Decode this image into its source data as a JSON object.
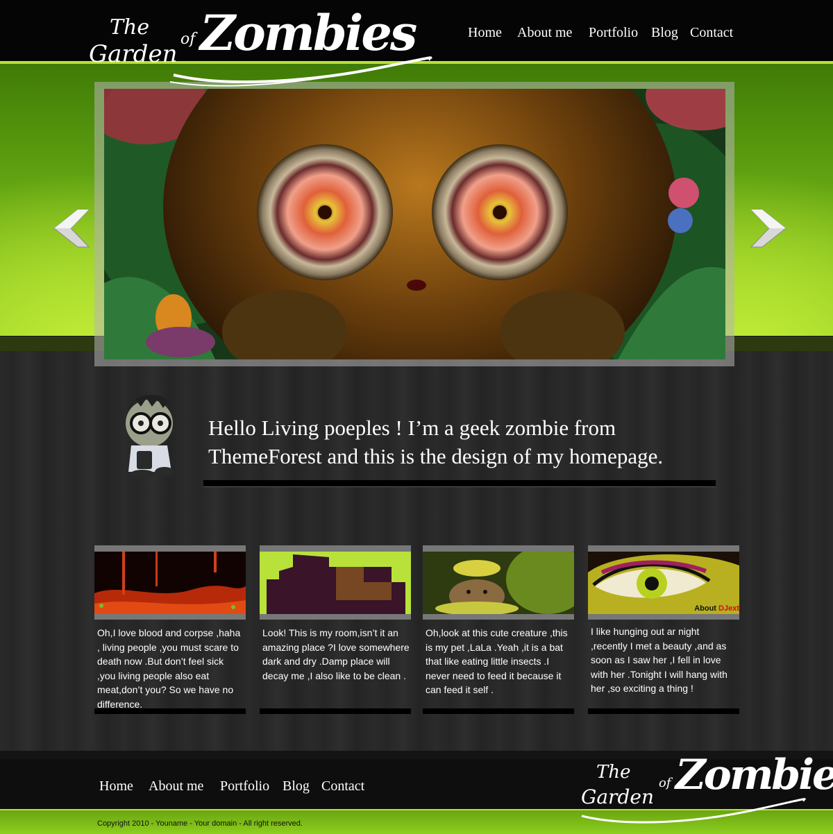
{
  "logo": {
    "the": "The",
    "garden": "Garden",
    "of": "of",
    "zombies": "Zombies"
  },
  "nav": [
    "Home",
    "About me",
    "Portfolio",
    "Blog",
    "Contact"
  ],
  "intro": {
    "text": "Hello Living poeples ! I’m a geek zombie from ThemeForest and this is the design of my homepage."
  },
  "cards": [
    {
      "text": "Oh,I love blood and corpse ,haha , living people ,you must  scare to death now .But don’t feel sick ,you living people also eat meat,don’t you? So we have no difference."
    },
    {
      "text": "Look! This is my room,isn’t it an amazing place ?I love somewhere dark and dry .Damp place will decay me ,I also like to be clean ."
    },
    {
      "text": "Oh,look at this cute creature ,this is my pet ,LaLa .Yeah ,it is a bat that  like eating little insects .I never need to feed it because it can feed it self ."
    },
    {
      "text": "I like hunging out ar night ,recently I met a beauty ,and as soon as I saw her ,I fell in love with her .Tonight I will hang with her ,so exciting a thing !"
    }
  ],
  "card4_caption": {
    "about": "About ",
    "djext": "DJext"
  },
  "footer": {
    "copyright": "Copyright 2010 - Youname - Your domain - All right reserved."
  }
}
